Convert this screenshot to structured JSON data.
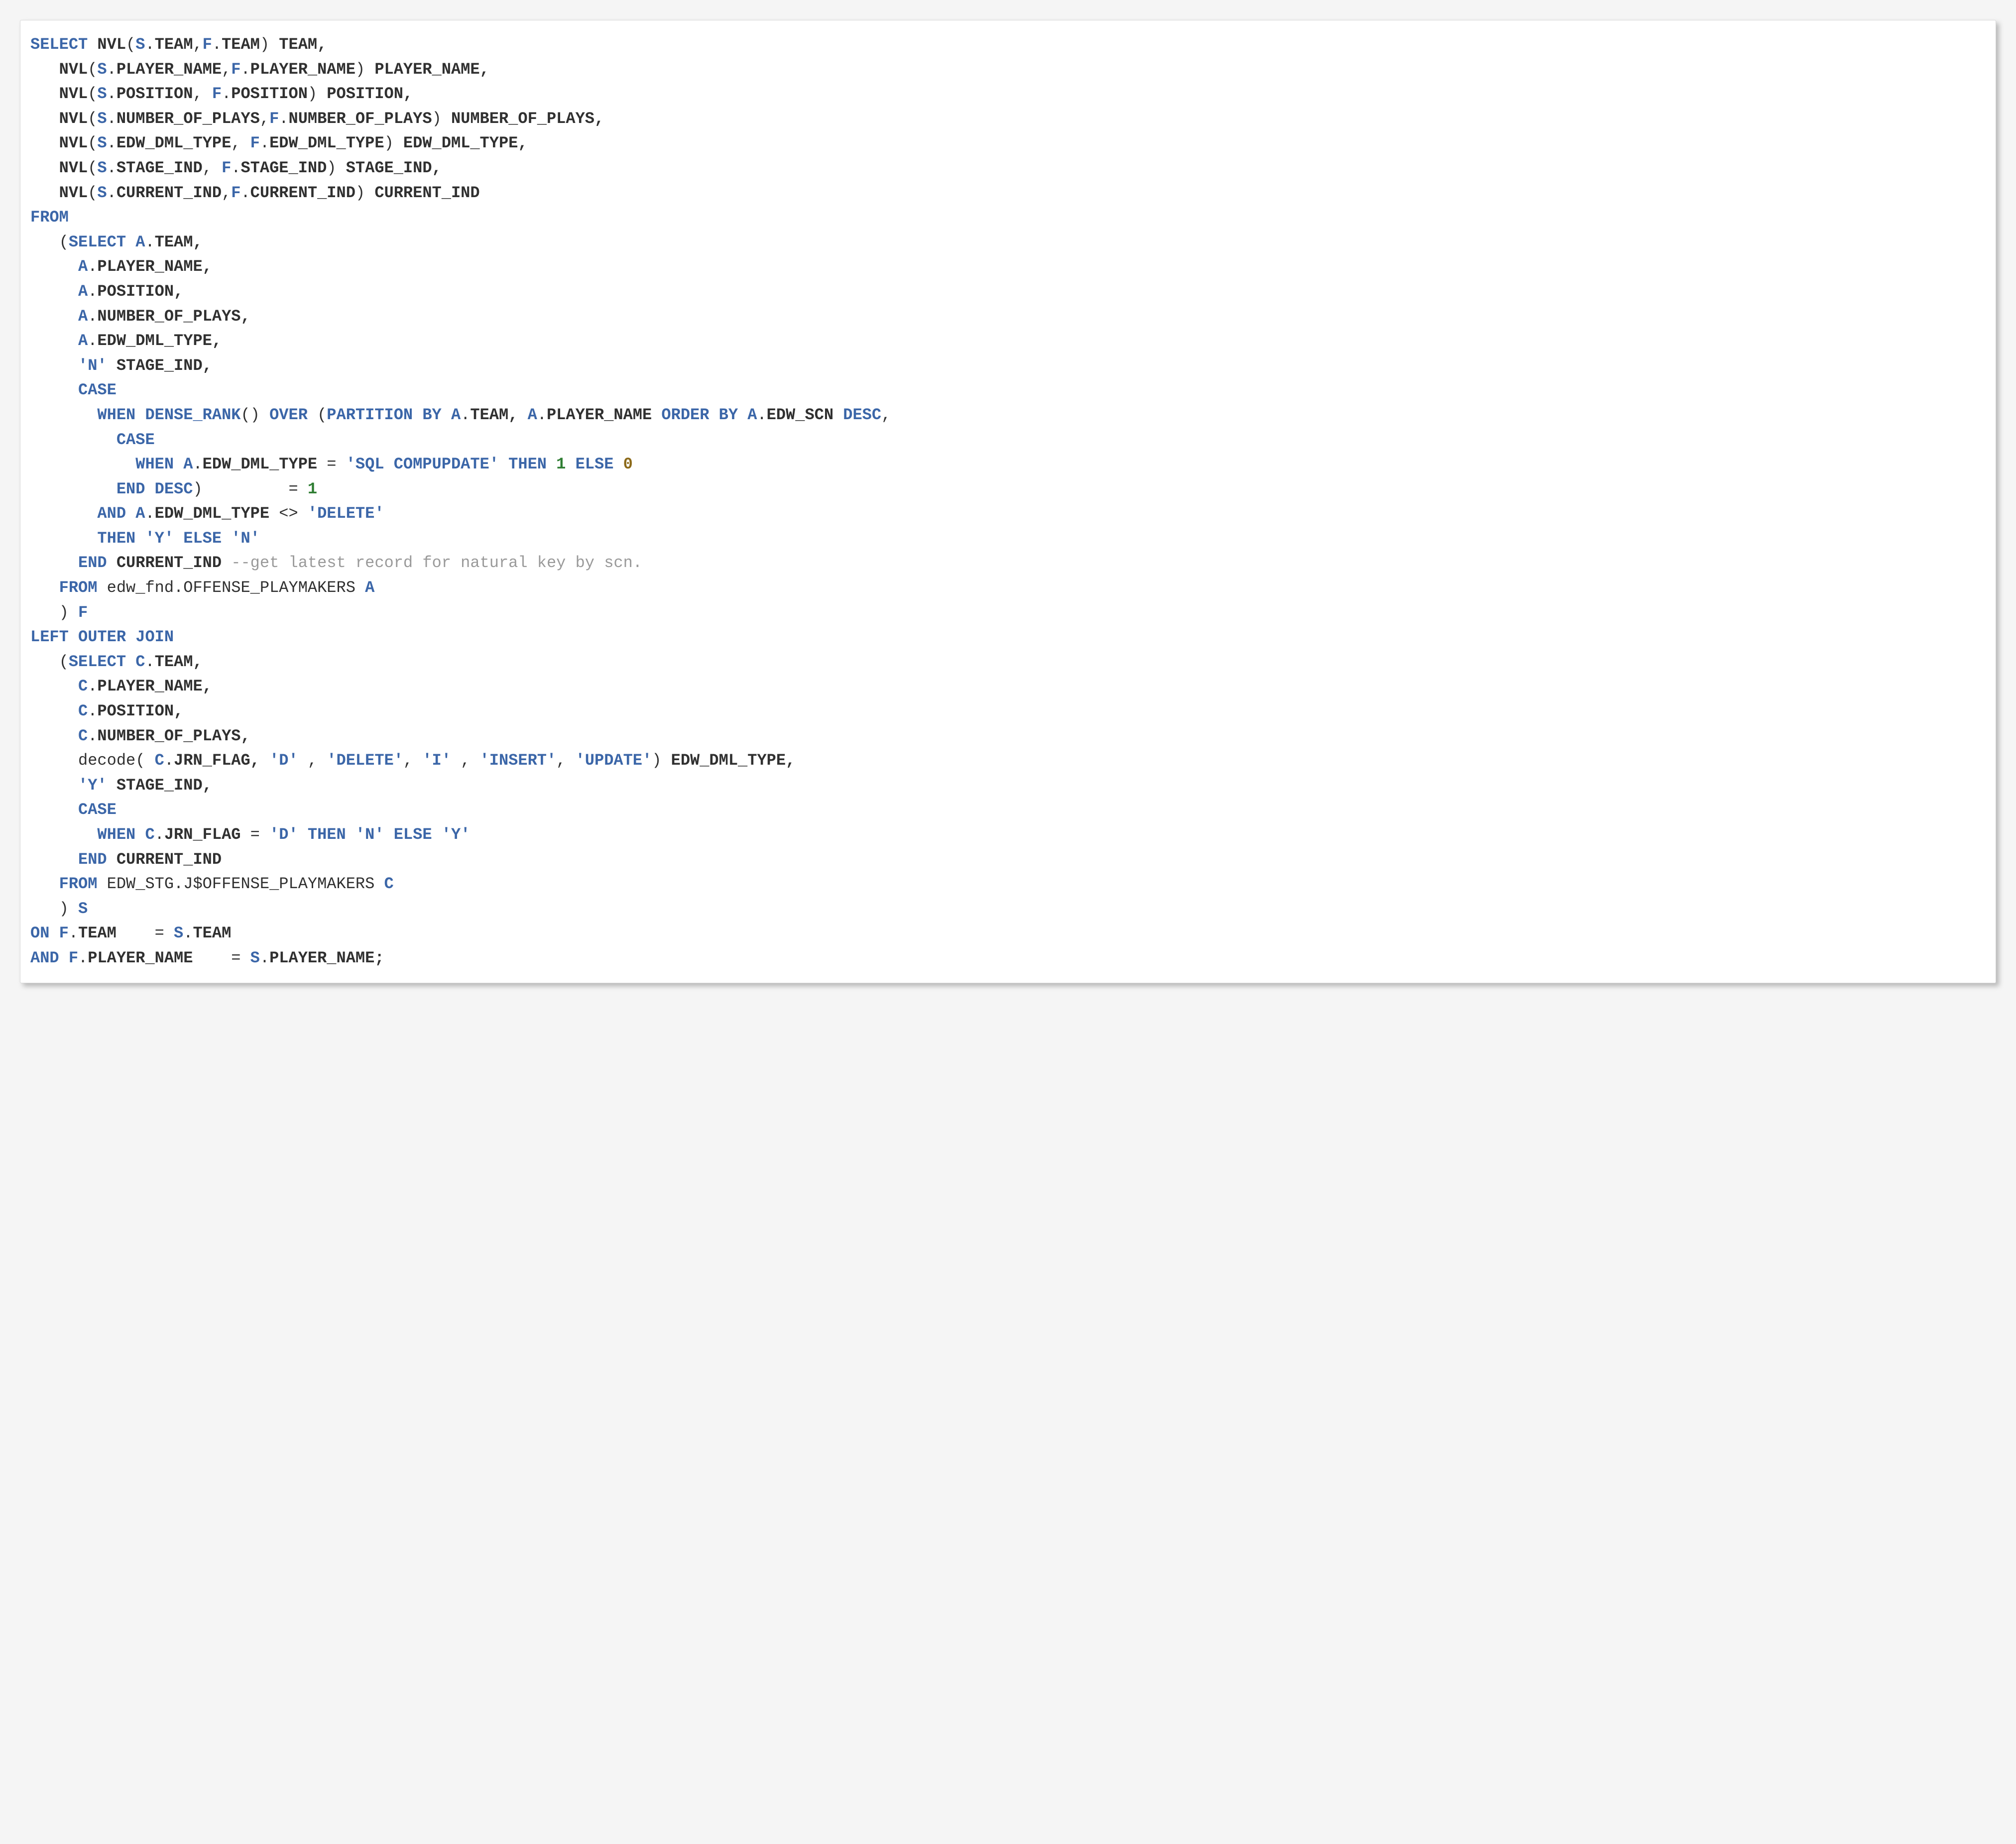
{
  "sql": {
    "l01": {
      "select": "SELECT",
      "nvl": "NVL",
      "sTeam": "S",
      "dot": ".",
      "team": "TEAM",
      "fTeam": "F",
      "alias": "TEAM,"
    },
    "l02": {
      "nvl": "NVL",
      "s": "S",
      "f": "F",
      "col": "PLAYER_NAME",
      "alias": "PLAYER_NAME,"
    },
    "l03": {
      "nvl": "NVL",
      "s": "S",
      "f": "F",
      "col": "POSITION",
      "alias": "POSITION,"
    },
    "l04": {
      "nvl": "NVL",
      "s": "S",
      "f": "F",
      "col": "NUMBER_OF_PLAYS",
      "alias": "NUMBER_OF_PLAYS,"
    },
    "l05": {
      "nvl": "NVL",
      "s": "S",
      "f": "F",
      "col": "EDW_DML_TYPE",
      "alias": "EDW_DML_TYPE,"
    },
    "l06": {
      "nvl": "NVL",
      "s": "S",
      "f": "F",
      "col": "STAGE_IND",
      "alias": "STAGE_IND,"
    },
    "l07": {
      "nvl": "NVL",
      "s": "S",
      "f": "F",
      "col": "CURRENT_IND",
      "alias": "CURRENT_IND"
    },
    "l08": {
      "from": "FROM"
    },
    "l09": {
      "select": "SELECT",
      "a": "A",
      "col": "TEAM,"
    },
    "l10": {
      "a": "A",
      "col": "PLAYER_NAME,"
    },
    "l11": {
      "a": "A",
      "col": "POSITION,"
    },
    "l12": {
      "a": "A",
      "col": "NUMBER_OF_PLAYS,"
    },
    "l13": {
      "a": "A",
      "col": "EDW_DML_TYPE,"
    },
    "l14": {
      "lit": "'N'",
      "alias": "STAGE_IND,"
    },
    "l15": {
      "case": "CASE"
    },
    "l16": {
      "when": "WHEN",
      "dr": "DENSE_RANK",
      "over": "OVER",
      "part": "PARTITION BY",
      "a": "A",
      "team": "TEAM,",
      "aName": "A",
      "player": "PLAYER_NAME",
      "order": "ORDER BY",
      "aScn": "A",
      "scn": "EDW_SCN",
      "desc": "DESC"
    },
    "l17": {
      "case": "CASE"
    },
    "l18": {
      "when": "WHEN",
      "a": "A",
      "col": "EDW_DML_TYPE",
      "eq": "=",
      "lit": "'SQL COMPUPDATE'",
      "then": "THEN",
      "one": "1",
      "else": "ELSE",
      "zero": "0"
    },
    "l19": {
      "end": "END",
      "desc": "DESC",
      "close": ")",
      "eq": "=",
      "one": "1"
    },
    "l20": {
      "and": "AND",
      "a": "A",
      "col": "EDW_DML_TYPE",
      "ne": "<>",
      "lit": "'DELETE'"
    },
    "l21": {
      "then": "THEN",
      "y": "'Y'",
      "else": "ELSE",
      "n": "'N'"
    },
    "l22": {
      "end": "END",
      "alias": "CURRENT_IND",
      "cmt": "--get latest record for natural key by scn."
    },
    "l23": {
      "from": "FROM",
      "schema": "edw_fnd.OFFENSE_PLAYMAKERS",
      "a": "A"
    },
    "l24": {
      "close": ")",
      "f": "F"
    },
    "l25": {
      "loj": "LEFT OUTER JOIN"
    },
    "l26": {
      "select": "SELECT",
      "c": "C",
      "col": "TEAM,"
    },
    "l27": {
      "c": "C",
      "col": "PLAYER_NAME,"
    },
    "l28": {
      "c": "C",
      "col": "POSITION,"
    },
    "l29": {
      "c": "C",
      "col": "NUMBER_OF_PLAYS,"
    },
    "l30": {
      "decode": "decode(",
      "c": "C",
      "jrn": "JRN_FLAG,",
      "d": "'D'",
      "com": ",",
      "delete": "'DELETE'",
      "i": "'I'",
      "insert": "'INSERT'",
      "update": "'UPDATE'",
      "close": ")",
      "alias": "EDW_DML_TYPE,"
    },
    "l31": {
      "lit": "'Y'",
      "alias": "STAGE_IND,"
    },
    "l32": {
      "case": "CASE"
    },
    "l33": {
      "when": "WHEN",
      "c": "C",
      "col": "JRN_FLAG",
      "eq": "=",
      "d": "'D'",
      "then": "THEN",
      "n": "'N'",
      "else": "ELSE",
      "y": "'Y'"
    },
    "l34": {
      "end": "END",
      "alias": "CURRENT_IND"
    },
    "l35": {
      "from": "FROM",
      "schema": "EDW_STG.J$OFFENSE_PLAYMAKERS",
      "c": "C"
    },
    "l36": {
      "close": ")",
      "s": "S"
    },
    "l37": {
      "on": "ON",
      "f": "F",
      "col": "TEAM",
      "eq": "=",
      "s": "S",
      "col2": "TEAM"
    },
    "l38": {
      "and": "AND",
      "f": "F",
      "col": "PLAYER_NAME",
      "eq": "=",
      "s": "S",
      "col2": "PLAYER_NAME;"
    }
  }
}
